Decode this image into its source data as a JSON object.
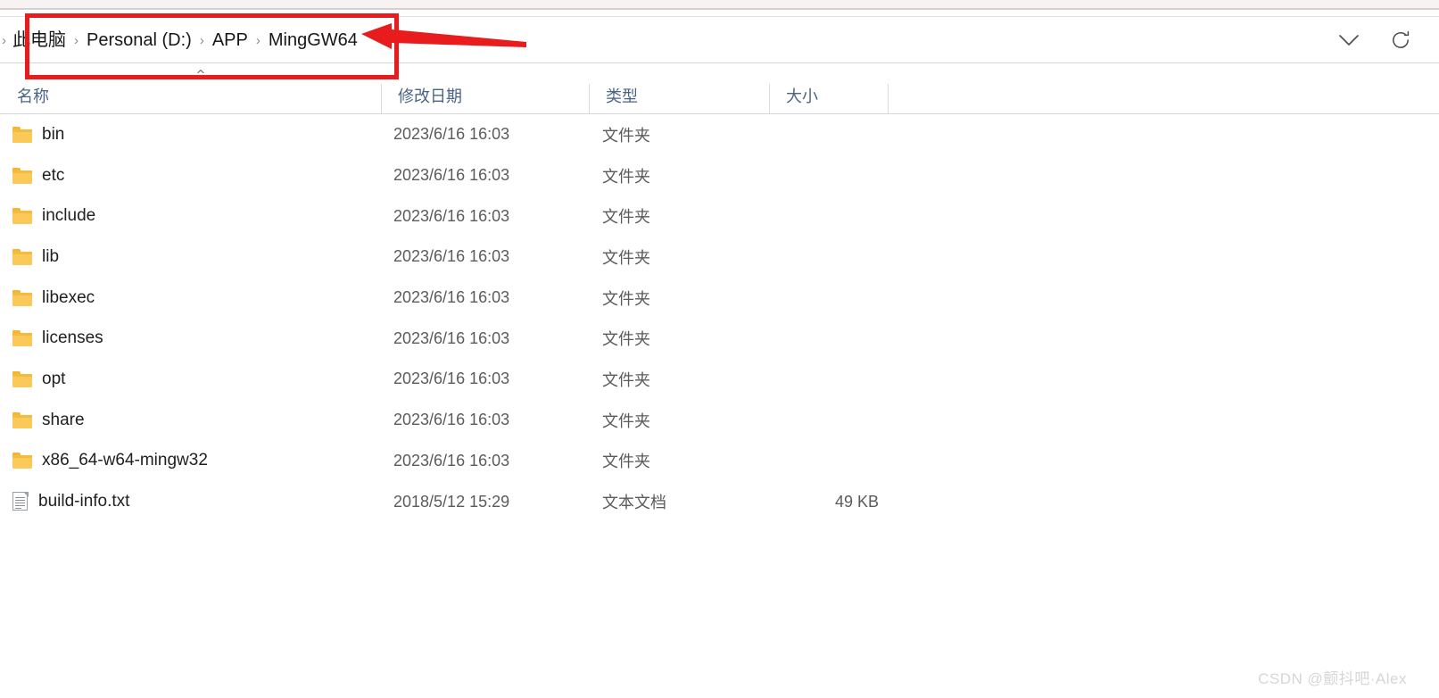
{
  "window": {
    "app": "Windows File Explorer"
  },
  "address_bar": {
    "leading_separator": "›",
    "separator": "›",
    "breadcrumbs": [
      "此电脑",
      "Personal (D:)",
      "APP",
      "MingGW64"
    ],
    "actions": [
      {
        "name": "history-dropdown",
        "icon": "chevron-down-icon"
      },
      {
        "name": "refresh",
        "icon": "refresh-icon"
      }
    ]
  },
  "columns": {
    "name": "名称",
    "date_modified": "修改日期",
    "type": "类型",
    "size": "大小",
    "sort_indicator": "^",
    "sort_column": "名称",
    "sort_direction": "ascending"
  },
  "files": [
    {
      "name": "bin",
      "icon": "folder-icon",
      "date": "2023/6/16 16:03",
      "type": "文件夹",
      "size": ""
    },
    {
      "name": "etc",
      "icon": "folder-icon",
      "date": "2023/6/16 16:03",
      "type": "文件夹",
      "size": ""
    },
    {
      "name": "include",
      "icon": "folder-icon",
      "date": "2023/6/16 16:03",
      "type": "文件夹",
      "size": ""
    },
    {
      "name": "lib",
      "icon": "folder-icon",
      "date": "2023/6/16 16:03",
      "type": "文件夹",
      "size": ""
    },
    {
      "name": "libexec",
      "icon": "folder-icon",
      "date": "2023/6/16 16:03",
      "type": "文件夹",
      "size": ""
    },
    {
      "name": "licenses",
      "icon": "folder-icon",
      "date": "2023/6/16 16:03",
      "type": "文件夹",
      "size": ""
    },
    {
      "name": "opt",
      "icon": "folder-icon",
      "date": "2023/6/16 16:03",
      "type": "文件夹",
      "size": ""
    },
    {
      "name": "share",
      "icon": "folder-icon",
      "date": "2023/6/16 16:03",
      "type": "文件夹",
      "size": ""
    },
    {
      "name": "x86_64-w64-mingw32",
      "icon": "folder-icon",
      "date": "2023/6/16 16:03",
      "type": "文件夹",
      "size": ""
    },
    {
      "name": "build-info.txt",
      "icon": "text-file-icon",
      "date": "2018/5/12 15:29",
      "type": "文本文档",
      "size": "49 KB"
    }
  ],
  "annotation": {
    "box_color": "#e81c1c",
    "arrow_color": "#e81c1c",
    "highlights": "address-bar-breadcrumb-path"
  },
  "watermark": {
    "text": "CSDN @颤抖吧·Alex",
    "color": "#d6d6d6"
  }
}
